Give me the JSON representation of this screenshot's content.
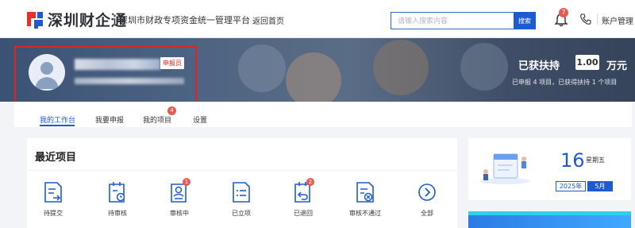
{
  "header": {
    "brand": "深圳财企通",
    "platform": "深圳市财政专项资金统一管理平台",
    "home_link": "返回首页",
    "search_placeholder": "请输入搜索内容",
    "search_button": "搜索",
    "notification_count": "7",
    "account": "账户管理",
    "icons": [
      "brand-logo-icon",
      "bell-icon",
      "phone-icon"
    ]
  },
  "profile": {
    "role_badge": "申报员",
    "support_label": "已获扶持",
    "support_value": "1.00",
    "support_unit": "万元",
    "support_sub": "已申报 4 项目，已获得扶持 1 个项目"
  },
  "tabs": [
    {
      "label": "我的工作台",
      "active": true
    },
    {
      "label": "我要申报"
    },
    {
      "label": "我的项目",
      "badge": "4"
    },
    {
      "label": "设置"
    }
  ],
  "recent": {
    "title": "最近项目",
    "items": [
      {
        "label": "待提交",
        "icon": "submit-doc-icon"
      },
      {
        "label": "待审核",
        "icon": "pending-review-icon"
      },
      {
        "label": "审核中",
        "icon": "reviewing-icon",
        "badge": "1"
      },
      {
        "label": "已立项",
        "icon": "approved-icon"
      },
      {
        "label": "已退回",
        "icon": "returned-icon",
        "badge": "2"
      },
      {
        "label": "审核不通过",
        "icon": "rejected-icon"
      },
      {
        "label": "全部",
        "icon": "chevron-right-circle-icon"
      }
    ]
  },
  "date": {
    "day": "16",
    "weekday": "星期五",
    "year": "2025年",
    "month": "5月"
  },
  "colors": {
    "accent": "#1e5bd0",
    "badge": "#e85a4f",
    "highlight_border": "#e02424",
    "brand_red": "#e8302a"
  }
}
